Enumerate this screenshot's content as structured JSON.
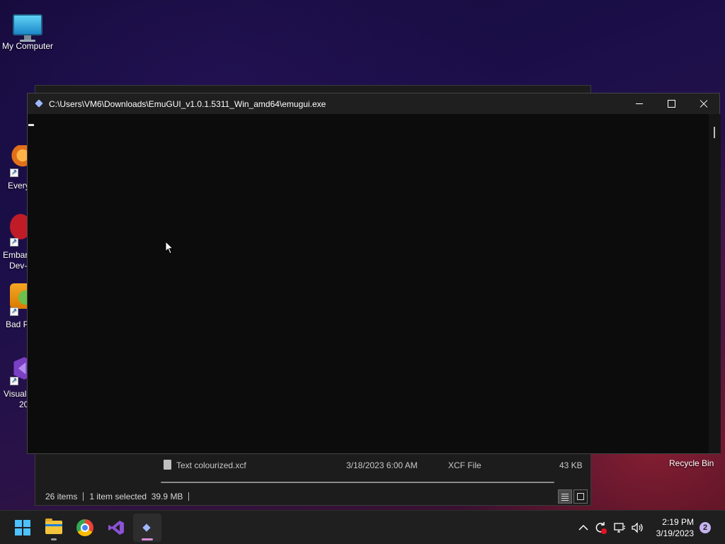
{
  "desktop": {
    "icons": [
      {
        "label": "My Computer"
      },
      {
        "label": "Every"
      },
      {
        "label": "Embar",
        "label2": "Dev-"
      },
      {
        "label": "Bad P"
      },
      {
        "label": "Visual",
        "label2": "20"
      }
    ],
    "recycle_bin": "Recycle Bin"
  },
  "console": {
    "title": "C:\\Users\\VM6\\Downloads\\EmuGUI_v1.0.1.5311_Win_amd64\\emugui.exe"
  },
  "explorer": {
    "file_row": {
      "name": "Text colourized.xcf",
      "date": "3/18/2023 6:00 AM",
      "type": "XCF File",
      "size": "43 KB"
    },
    "status": {
      "items": "26 items",
      "selected": "1 item selected",
      "size": "39.9 MB"
    }
  },
  "taskbar": {
    "apps": [
      "start-icon",
      "file-explorer-icon",
      "chrome-icon",
      "visual-studio-icon",
      "emugui-icon"
    ],
    "clock": {
      "time": "2:19 PM",
      "date": "3/19/2023"
    },
    "notification_count": "2"
  },
  "colors": {
    "accent": "#4cc2ff",
    "console_bg": "#0c0c0c",
    "taskbar_bg": "#1f1f1f"
  }
}
